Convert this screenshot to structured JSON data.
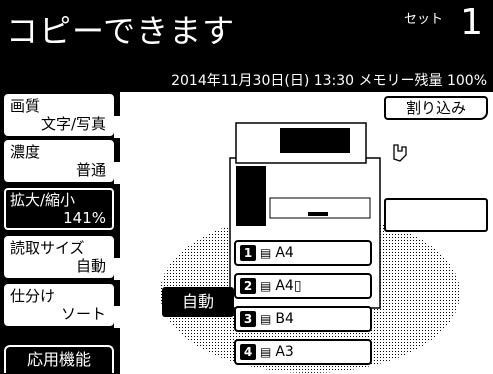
{
  "header": {
    "title": "コピーできます",
    "set_label": "セット",
    "count": "1",
    "datetime": "2014年11月30日(日) 13:30 メモリー残量 100%"
  },
  "left_menu": {
    "items": [
      {
        "l1": "画質",
        "l2": "文字/写真"
      },
      {
        "l1": "濃度",
        "l2": "普通"
      },
      {
        "l1": "拡大/縮小",
        "l2": "141%"
      },
      {
        "l1": "読取サイズ",
        "l2": "自動"
      },
      {
        "l1": "仕分け",
        "l2": "ソート"
      }
    ],
    "app_functions": "応用機能"
  },
  "main": {
    "interrupt": "割り込み",
    "auto": "自動",
    "trays": [
      {
        "num": "1",
        "icon": "paper-icon",
        "size": "A4"
      },
      {
        "num": "2",
        "icon": "paper-icon",
        "size": "A4▯"
      },
      {
        "num": "3",
        "icon": "paper-icon",
        "size": "B4"
      },
      {
        "num": "4",
        "icon": "paper-icon",
        "size": "A3"
      }
    ]
  }
}
